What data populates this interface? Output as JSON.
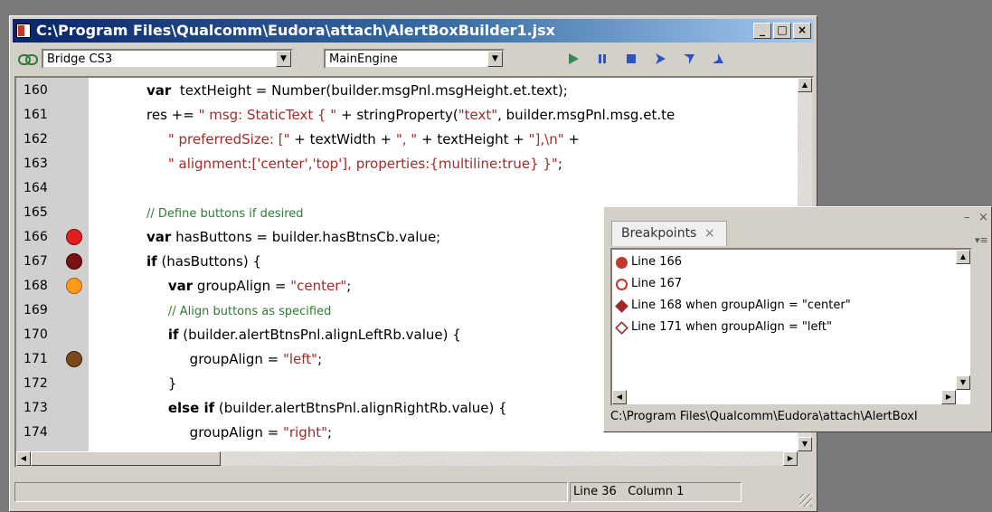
{
  "window": {
    "title": "C:\\Program Files\\Qualcomm\\Eudora\\attach\\AlertBoxBuilder1.jsx",
    "minimize": "_",
    "maximize": "□",
    "close": "×"
  },
  "toolbar": {
    "target": "Bridge CS3",
    "engine": "MainEngine"
  },
  "editor": {
    "lines": [
      {
        "num": "160",
        "code": [
          [
            "kw",
            "var"
          ],
          [
            "",
            "  textHeight = Number(builder.msgPnl.msgHeight.et.text);"
          ]
        ]
      },
      {
        "num": "161",
        "code": [
          [
            "",
            "res += "
          ],
          [
            "str",
            "\" msg: StaticText { \""
          ],
          [
            "",
            " + stringProperty("
          ],
          [
            "str",
            "\"text\""
          ],
          [
            "",
            ", builder.msgPnl.msg.et.te"
          ]
        ]
      },
      {
        "num": "162",
        "code": [
          [
            "",
            "     "
          ],
          [
            "str",
            "\" preferredSize: [\""
          ],
          [
            "",
            " + textWidth + "
          ],
          [
            "str",
            "\", \""
          ],
          [
            "",
            " + textHeight + "
          ],
          [
            "str",
            "\"],\\n\""
          ],
          [
            "",
            " +"
          ]
        ]
      },
      {
        "num": "163",
        "code": [
          [
            "",
            "     "
          ],
          [
            "str",
            "\" alignment:['center','top'], properties:{multiline:true} }\""
          ],
          [
            "",
            ";"
          ]
        ]
      },
      {
        "num": "164",
        "code": []
      },
      {
        "num": "165",
        "code": [
          [
            "cm",
            "// Define buttons if desired"
          ]
        ]
      },
      {
        "num": "166",
        "code": [
          [
            "kw",
            "var"
          ],
          [
            "",
            " hasButtons = builder.hasBtnsCb.value;"
          ]
        ]
      },
      {
        "num": "167",
        "code": [
          [
            "kw",
            "if"
          ],
          [
            "",
            " (hasButtons) {"
          ]
        ]
      },
      {
        "num": "168",
        "code": [
          [
            "",
            "     "
          ],
          [
            "kw",
            "var"
          ],
          [
            "",
            " groupAlign = "
          ],
          [
            "str",
            "\"center\""
          ],
          [
            "",
            ";"
          ]
        ]
      },
      {
        "num": "169",
        "code": [
          [
            "",
            "     "
          ],
          [
            "cm",
            "// Align buttons as specified"
          ]
        ]
      },
      {
        "num": "170",
        "code": [
          [
            "",
            "     "
          ],
          [
            "kw",
            "if"
          ],
          [
            "",
            " (builder.alertBtnsPnl.alignLeftRb.value) {"
          ]
        ]
      },
      {
        "num": "171",
        "code": [
          [
            "",
            "          groupAlign = "
          ],
          [
            "str",
            "\"left\""
          ],
          [
            "",
            ";"
          ]
        ]
      },
      {
        "num": "172",
        "code": [
          [
            "",
            "     }"
          ]
        ]
      },
      {
        "num": "173",
        "code": [
          [
            "",
            "     "
          ],
          [
            "kw",
            "else if"
          ],
          [
            "",
            " (builder.alertBtnsPnl.alignRightRb.value) {"
          ]
        ]
      },
      {
        "num": "174",
        "code": [
          [
            "",
            "          groupAlign = "
          ],
          [
            "str",
            "\"right\""
          ],
          [
            "",
            ";"
          ]
        ]
      }
    ],
    "breakpoints": [
      {
        "line": "166",
        "color": "#e02020",
        "border": "#8b0000"
      },
      {
        "line": "167",
        "color": "#7a1010",
        "border": "#3a0000"
      },
      {
        "line": "168",
        "color": "#ff9a1a",
        "border": "#b35c00"
      },
      {
        "line": "171",
        "color": "#7a4a1a",
        "border": "#3b2000"
      }
    ]
  },
  "statusbar": {
    "line": "Line 36",
    "column": "Column 1"
  },
  "breakpoints_panel": {
    "tab_label": "Breakpoints",
    "items": [
      {
        "label": "Line 166",
        "icon": "filled-circle",
        "color": "#c0392b"
      },
      {
        "label": "Line 167",
        "icon": "hollow-circle",
        "color": "#c0392b"
      },
      {
        "label": "Line 168 when groupAlign = \"center\"",
        "icon": "filled-diamond",
        "color": "#a0282b"
      },
      {
        "label": "Line 171 when groupAlign = \"left\"",
        "icon": "hollow-diamond",
        "color": "#a0282b"
      }
    ],
    "path": "C:\\Program Files\\Qualcomm\\Eudora\\attach\\AlertBoxI"
  }
}
